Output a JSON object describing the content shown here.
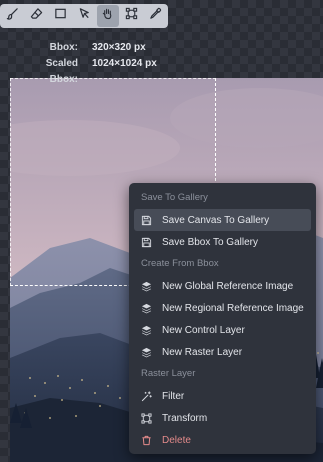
{
  "toolbar": {
    "tools": [
      {
        "icon": "brush-icon",
        "active": false
      },
      {
        "icon": "eraser-icon",
        "active": false
      },
      {
        "icon": "rectangle-icon",
        "active": false
      },
      {
        "icon": "move-cursor-icon",
        "active": false
      },
      {
        "icon": "hand-icon",
        "active": true
      },
      {
        "icon": "transform-bbox-icon",
        "active": false
      },
      {
        "icon": "color-picker-icon",
        "active": false
      }
    ]
  },
  "bbox_info": {
    "bbox_label": "Bbox:",
    "bbox_value": "320×320 px",
    "scaled_label": "Scaled Bbox:",
    "scaled_value": "1024×1024 px"
  },
  "menu": {
    "group_save": "Save To Gallery",
    "save_canvas": "Save Canvas To Gallery",
    "save_bbox": "Save Bbox To Gallery",
    "group_create": "Create From Bbox",
    "new_global_ref": "New Global Reference Image",
    "new_regional_ref": "New Regional Reference Image",
    "new_control": "New Control Layer",
    "new_raster": "New Raster Layer",
    "group_raster": "Raster Layer",
    "filter": "Filter",
    "transform": "Transform",
    "delete": "Delete"
  },
  "colors": {
    "menu_bg": "#2f333c",
    "menu_highlight": "#474c57",
    "danger": "#e38a8a",
    "toolbar_bg": "#c9ccd4"
  }
}
